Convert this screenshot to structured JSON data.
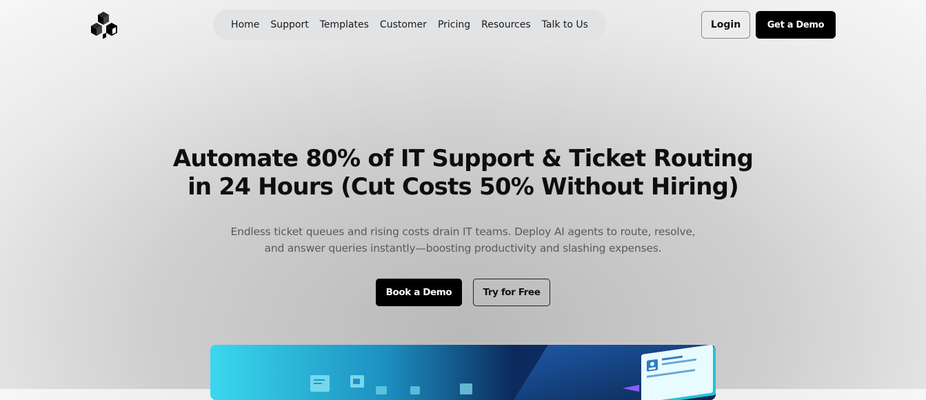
{
  "header": {
    "logo_icon": "cubes-logo-icon",
    "nav_items": [
      "Home",
      "Support",
      "Templates",
      "Customer",
      "Pricing",
      "Resources",
      "Talk to Us"
    ],
    "login_label": "Login",
    "demo_label": "Get a Demo"
  },
  "hero": {
    "headline_line1": "Automate 80% of IT Support & Ticket Routing",
    "headline_line2": "in 24 Hours (Cut Costs 50% Without Hiring)",
    "subtext_line1": "Endless ticket queues and rising costs drain IT teams. Deploy AI agents to route, resolve,",
    "subtext_line2": "and answer queries instantly—boosting productivity and slashing expenses.",
    "primary_cta": "Book a Demo",
    "secondary_cta": "Try for Free",
    "illustration_icon": "ai-ticket-routing-illustration"
  },
  "colors": {
    "primary": "#000000",
    "nav_bg": "#e2e3e5",
    "subtext": "#565a62",
    "illustration_cyan": "#3ad8ee",
    "illustration_navy": "#0c2a5c"
  }
}
